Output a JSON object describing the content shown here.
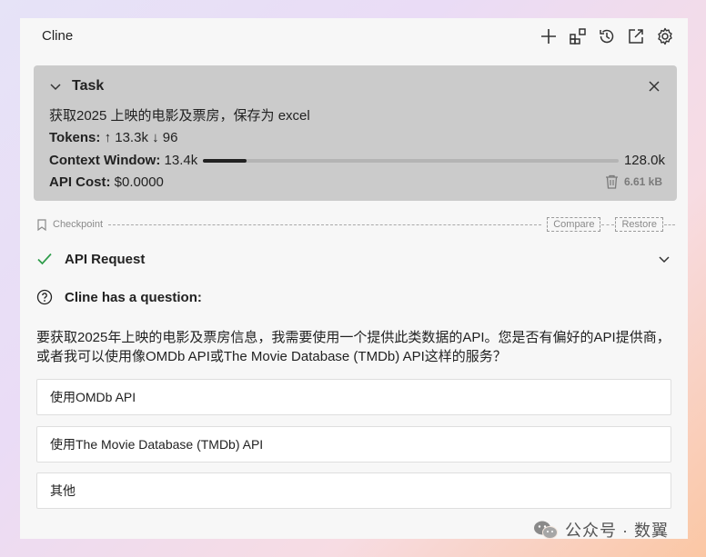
{
  "app": {
    "title": "Cline"
  },
  "toolbar": {
    "icons": [
      "plus-icon",
      "mcp-servers-icon",
      "history-icon",
      "open-external-icon",
      "gear-icon"
    ]
  },
  "task": {
    "label": "Task",
    "text": "获取2025 上映的电影及票房，保存为 excel",
    "tokens_label": "Tokens:",
    "tokens_up": "↑ 13.3k",
    "tokens_down": "↓ 96",
    "context_label": "Context Window:",
    "context_used": "13.4k",
    "context_max": "128.0k",
    "context_fraction": 0.105,
    "cost_label": "API Cost:",
    "cost_value": "$0.0000",
    "size": "6.61 kB"
  },
  "checkpoint": {
    "label": "Checkpoint",
    "compare": "Compare",
    "restore": "Restore"
  },
  "api_request": {
    "label": "API Request"
  },
  "question": {
    "label": "Cline has a question:",
    "text": "要获取2025年上映的电影及票房信息，我需要使用一个提供此类数据的API。您是否有偏好的API提供商，或者我可以使用像OMDb API或The Movie Database (TMDb) API这样的服务？",
    "options": [
      "使用OMDb API",
      "使用The Movie Database (TMDb) API",
      "其他"
    ]
  },
  "watermark": {
    "text": "公众号 · 数翼"
  },
  "colors": {
    "check": "#2e9c4a",
    "panel": "#f7f7f7",
    "task_bg": "#cbcbcb"
  }
}
